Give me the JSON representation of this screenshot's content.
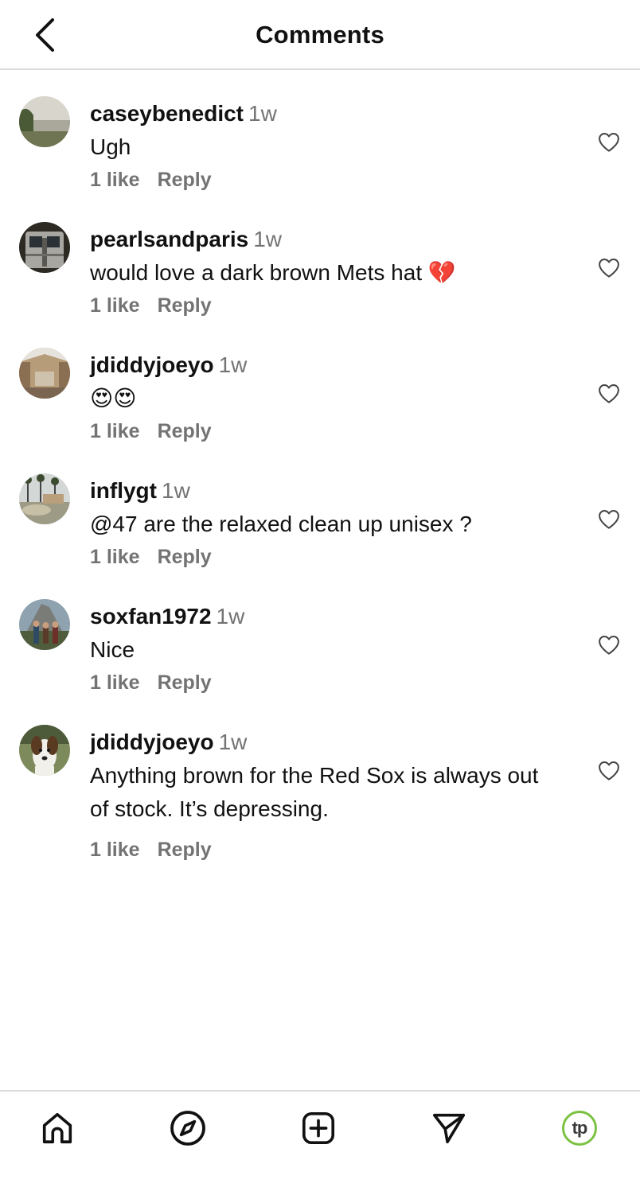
{
  "header": {
    "title": "Comments",
    "back_icon": "chevron-left-icon"
  },
  "comments": [
    {
      "username": "caseybenedict",
      "time": "1w",
      "text": "Ugh",
      "likes": "1 like",
      "reply": "Reply",
      "avatar": "lake-landscape"
    },
    {
      "username": "pearlsandparis",
      "time": "1w",
      "text": "would love a dark brown Mets hat 💔",
      "likes": "1 like",
      "reply": "Reply",
      "avatar": "subway-train"
    },
    {
      "username": "jdiddyjoeyo",
      "time": "1w",
      "text": "😍😍",
      "likes": "1 like",
      "reply": "Reply",
      "avatar": "mall-interior"
    },
    {
      "username": "inflygt",
      "time": "1w",
      "text": "@47 are the relaxed clean up unisex ?",
      "likes": "1 like",
      "reply": "Reply",
      "avatar": "palm-street-car"
    },
    {
      "username": "soxfan1972",
      "time": "1w",
      "text": "Nice",
      "likes": "1 like",
      "reply": "Reply",
      "avatar": "mountain-people"
    },
    {
      "username": "jdiddyjoeyo",
      "time": "1w",
      "text": "Anything brown for the Red Sox is always out of stock. It’s depressing.",
      "likes": "1 like",
      "reply": "Reply",
      "avatar": "dog"
    }
  ],
  "tabbar": {
    "tabs": [
      {
        "icon": "home-icon"
      },
      {
        "icon": "compass-icon"
      },
      {
        "icon": "add-post-icon"
      },
      {
        "icon": "send-icon"
      },
      {
        "icon": "profile-avatar",
        "label": "tp"
      }
    ]
  },
  "colors": {
    "text": "#111111",
    "muted": "#737373",
    "divider": "#dbdbdb",
    "profile_ring": "#7cc242"
  }
}
